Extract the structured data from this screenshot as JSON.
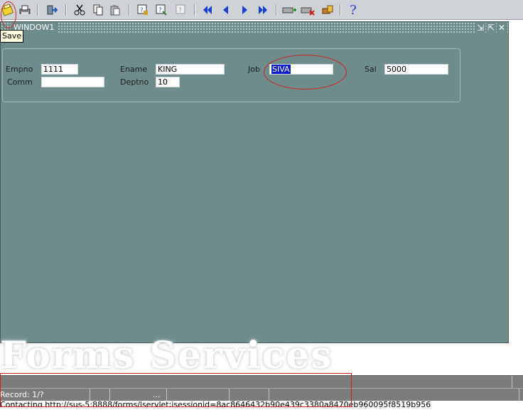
{
  "toolbar": {
    "buttons": [
      {
        "name": "save",
        "icon": "save-icon"
      },
      {
        "name": "print",
        "icon": "printer-icon"
      },
      {
        "name": "exit",
        "icon": "exit-icon"
      },
      {
        "name": "cut",
        "icon": "scissors-icon"
      },
      {
        "name": "copy",
        "icon": "copy-icon"
      },
      {
        "name": "paste",
        "icon": "paste-icon"
      },
      {
        "name": "enter-query",
        "icon": "enter-query-icon"
      },
      {
        "name": "execute-query",
        "icon": "execute-query-icon"
      },
      {
        "name": "cancel-query",
        "icon": "cancel-query-icon"
      },
      {
        "name": "previous-block",
        "icon": "first-icon"
      },
      {
        "name": "previous-record",
        "icon": "previous-icon"
      },
      {
        "name": "next-record",
        "icon": "next-icon"
      },
      {
        "name": "next-block",
        "icon": "last-icon"
      },
      {
        "name": "insert-record",
        "icon": "insert-record-icon"
      },
      {
        "name": "delete-record",
        "icon": "delete-record-icon"
      },
      {
        "name": "lock-record",
        "icon": "lock-record-icon"
      },
      {
        "name": "help",
        "icon": "help-icon"
      }
    ],
    "help_label": "?"
  },
  "tooltip": {
    "text": "Save"
  },
  "window": {
    "title": "WINDOW1",
    "controls": {
      "minimize": "⇲",
      "maximize": "⇱",
      "close": "✕"
    }
  },
  "form": {
    "empno": {
      "label": "Empno",
      "value": "1111"
    },
    "ename": {
      "label": "Ename",
      "value": "KING"
    },
    "job": {
      "label": "Job",
      "value": "SIVA"
    },
    "sal": {
      "label": "Sal",
      "value": "5000"
    },
    "comm": {
      "label": "Comm",
      "value": ""
    },
    "deptno": {
      "label": "Deptno",
      "value": "10"
    }
  },
  "watermark": {
    "text": "Forms Services"
  },
  "status": {
    "record": "Record: 1/?",
    "dots": "...",
    "url": "Contacting http://sus-5:8888/forms/lservlet;jsessionid=8ac8646432b90e439c3380a8470eb960095f8519b956"
  },
  "colors": {
    "window_bg": "#6f8c8c",
    "toolbar_bg": "#cfd3d8",
    "annotation_red": "#d02020",
    "selection_blue": "#0a1bd1"
  }
}
